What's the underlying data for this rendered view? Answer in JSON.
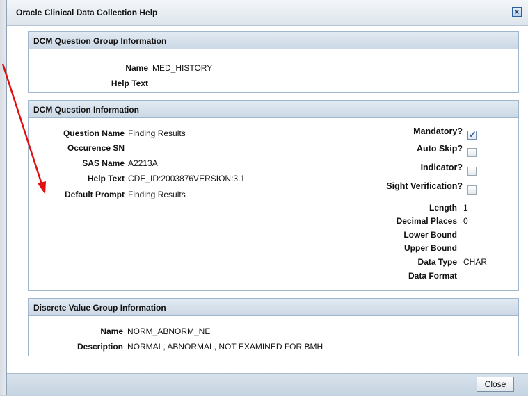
{
  "dialog": {
    "title": "Oracle Clinical Data Collection Help",
    "close_glyph": "×",
    "close_button_label": "Close"
  },
  "question_group": {
    "header": "DCM Question Group Information",
    "name_label": "Name",
    "name_value": "MED_HISTORY",
    "help_label": "Help Text",
    "help_value": ""
  },
  "question": {
    "header": "DCM Question Information",
    "left_fields": [
      {
        "label": "Question Name",
        "value": "Finding Results"
      },
      {
        "label": "Occurence SN",
        "value": ""
      },
      {
        "label": "SAS Name",
        "value": "A2213A"
      },
      {
        "label": "Help Text",
        "value": "CDE_ID:2003876VERSION:3.1"
      },
      {
        "label": "Default Prompt",
        "value": "Finding Results"
      }
    ],
    "checkboxes": [
      {
        "label": "Mandatory?",
        "checked": true
      },
      {
        "label": "Auto Skip?",
        "checked": false
      },
      {
        "label": "Indicator?",
        "checked": false
      },
      {
        "label": "Sight Verification?",
        "checked": false
      }
    ],
    "right_fields": [
      {
        "label": "Length",
        "value": "1"
      },
      {
        "label": "Decimal Places",
        "value": "0"
      },
      {
        "label": "Lower Bound",
        "value": ""
      },
      {
        "label": "Upper Bound",
        "value": ""
      },
      {
        "label": "Data Type",
        "value": "CHAR"
      },
      {
        "label": "Data Format",
        "value": ""
      }
    ]
  },
  "discrete_value_group": {
    "header": "Discrete Value Group Information",
    "name_label": "Name",
    "name_value": "NORM_ABNORM_NE",
    "description_label": "Description",
    "description_value": "NORMAL, ABNORMAL, NOT EXAMINED FOR BMH"
  },
  "colors": {
    "annotation_arrow": "#e01010",
    "panel_header": "#cbd8e5",
    "footer": "#c5d3e1"
  }
}
